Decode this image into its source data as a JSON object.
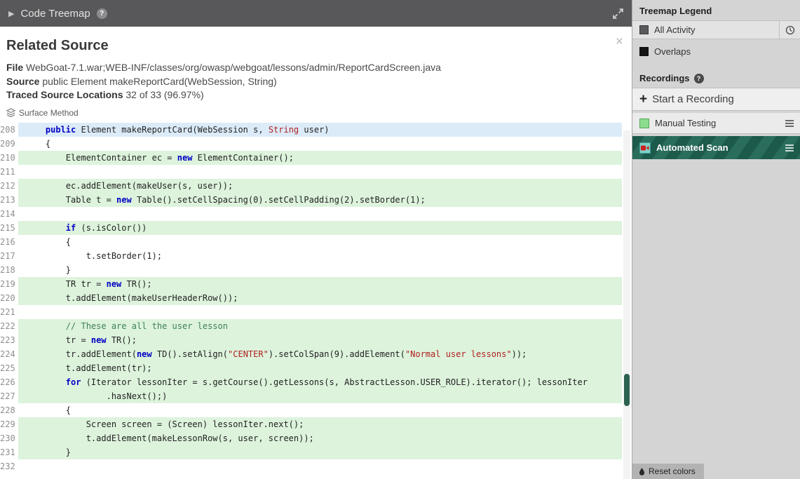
{
  "icons": {
    "help": "?",
    "plus": "+",
    "close": "×",
    "collapse": "▶"
  },
  "topbar": {
    "title": "Code Treemap"
  },
  "panel": {
    "title": "Related Source",
    "file_label": "File",
    "file_value": "WebGoat-7.1.war;WEB-INF/classes/org/owasp/webgoat/lessons/admin/ReportCardScreen.java",
    "source_label": "Source",
    "source_value": "public Element makeReportCard(WebSession, String)",
    "traced_label": "Traced Source Locations",
    "traced_value": "32 of 33 (96.97%)",
    "surface_method": "Surface Method"
  },
  "code": {
    "lines": [
      {
        "n": "208",
        "h": "blue",
        "p": [
          [
            "p",
            "    "
          ],
          [
            "k",
            "public"
          ],
          [
            "p",
            " Element makeReportCard(WebSession s, "
          ],
          [
            "s",
            "String"
          ],
          [
            "p",
            " user)"
          ]
        ]
      },
      {
        "n": "209",
        "h": "",
        "p": [
          [
            "p",
            "    {"
          ]
        ]
      },
      {
        "n": "210",
        "h": "green",
        "p": [
          [
            "p",
            "        ElementContainer ec = "
          ],
          [
            "k",
            "new"
          ],
          [
            "p",
            " ElementContainer();"
          ]
        ]
      },
      {
        "n": "211",
        "h": "",
        "p": []
      },
      {
        "n": "212",
        "h": "green",
        "p": [
          [
            "p",
            "        ec.addElement(makeUser(s, user));"
          ]
        ]
      },
      {
        "n": "213",
        "h": "green",
        "p": [
          [
            "p",
            "        Table t = "
          ],
          [
            "k",
            "new"
          ],
          [
            "p",
            " Table().setCellSpacing(0).setCellPadding(2).setBorder(1);"
          ]
        ]
      },
      {
        "n": "214",
        "h": "",
        "p": []
      },
      {
        "n": "215",
        "h": "green",
        "p": [
          [
            "p",
            "        "
          ],
          [
            "k",
            "if"
          ],
          [
            "p",
            " (s.isColor())"
          ]
        ]
      },
      {
        "n": "216",
        "h": "",
        "p": [
          [
            "p",
            "        {"
          ]
        ]
      },
      {
        "n": "217",
        "h": "",
        "p": [
          [
            "p",
            "            t.setBorder(1);"
          ]
        ]
      },
      {
        "n": "218",
        "h": "",
        "p": [
          [
            "p",
            "        }"
          ]
        ]
      },
      {
        "n": "219",
        "h": "green",
        "p": [
          [
            "p",
            "        TR tr = "
          ],
          [
            "k",
            "new"
          ],
          [
            "p",
            " TR();"
          ]
        ]
      },
      {
        "n": "220",
        "h": "green",
        "p": [
          [
            "p",
            "        t.addElement(makeUserHeaderRow());"
          ]
        ]
      },
      {
        "n": "221",
        "h": "",
        "p": []
      },
      {
        "n": "222",
        "h": "green",
        "p": [
          [
            "c",
            "        // These are all the user lesson"
          ]
        ]
      },
      {
        "n": "223",
        "h": "green",
        "p": [
          [
            "p",
            "        tr = "
          ],
          [
            "k",
            "new"
          ],
          [
            "p",
            " TR();"
          ]
        ]
      },
      {
        "n": "224",
        "h": "green",
        "p": [
          [
            "p",
            "        tr.addElement("
          ],
          [
            "k",
            "new"
          ],
          [
            "p",
            " TD().setAlign("
          ],
          [
            "s",
            "\"CENTER\""
          ],
          [
            "p",
            ").setColSpan(9).addElement("
          ],
          [
            "s",
            "\"Normal user lessons\""
          ],
          [
            "p",
            "));"
          ]
        ]
      },
      {
        "n": "225",
        "h": "green",
        "p": [
          [
            "p",
            "        t.addElement(tr);"
          ]
        ]
      },
      {
        "n": "226",
        "h": "green",
        "p": [
          [
            "p",
            "        "
          ],
          [
            "k",
            "for"
          ],
          [
            "p",
            " (Iterator lessonIter = s.getCourse().getLessons(s, AbstractLesson.USER_ROLE).iterator(); lessonIter"
          ]
        ]
      },
      {
        "n": "227",
        "h": "green",
        "p": [
          [
            "p",
            "                .hasNext();)"
          ]
        ]
      },
      {
        "n": "228",
        "h": "",
        "p": [
          [
            "p",
            "        {"
          ]
        ]
      },
      {
        "n": "229",
        "h": "green",
        "p": [
          [
            "p",
            "            Screen screen = (Screen) lessonIter.next();"
          ]
        ]
      },
      {
        "n": "230",
        "h": "green",
        "p": [
          [
            "p",
            "            t.addElement(makeLessonRow(s, user, screen));"
          ]
        ]
      },
      {
        "n": "231",
        "h": "green",
        "p": [
          [
            "p",
            "        }"
          ]
        ]
      },
      {
        "n": "232",
        "h": "",
        "p": []
      }
    ]
  },
  "sidebar": {
    "legend_title": "Treemap Legend",
    "legend": [
      {
        "label": "All Activity",
        "swatch": "#5a5a5c",
        "clock_button": true
      },
      {
        "label": "Overlaps",
        "swatch": "#151515",
        "clock_button": false
      }
    ],
    "recordings_title": "Recordings",
    "start_recording_label": "Start a Recording",
    "recordings": [
      {
        "label": "Manual Testing",
        "swatch": "#8edc8e",
        "swatch_border": "#55a855",
        "active": false,
        "record_icon": false
      },
      {
        "label": "Automated Scan",
        "swatch": "#7fd2c8",
        "swatch_border": "#3f9a90",
        "active": true,
        "record_icon": true
      }
    ],
    "reset_colors_label": "Reset colors"
  }
}
